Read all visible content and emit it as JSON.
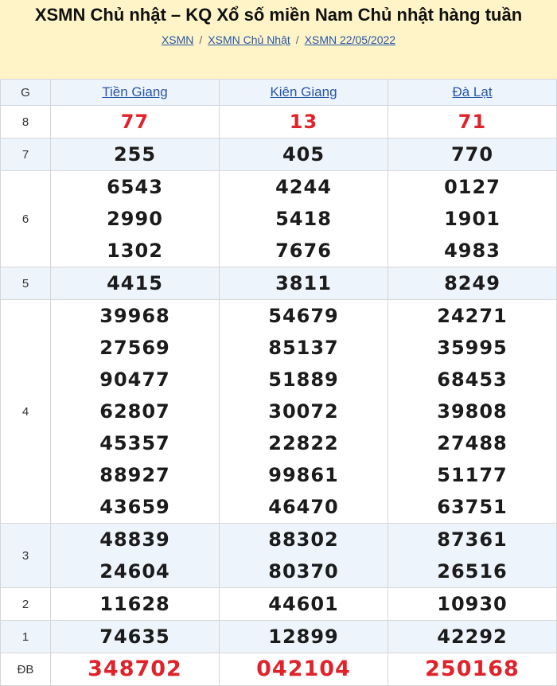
{
  "header": {
    "title": "XSMN Chủ nhật – KQ Xổ số miền Nam Chủ nhật hàng tuần",
    "breadcrumb": [
      "XSMN",
      "XSMN Chủ Nhật",
      "XSMN 22/05/2022"
    ]
  },
  "table": {
    "col_g": "G",
    "provinces": [
      "Tiền Giang",
      "Kiên Giang",
      "Đà Lạt"
    ],
    "rows": [
      {
        "g": "8",
        "vals": [
          [
            "77"
          ],
          [
            "13"
          ],
          [
            "71"
          ]
        ]
      },
      {
        "g": "7",
        "vals": [
          [
            "255"
          ],
          [
            "405"
          ],
          [
            "770"
          ]
        ]
      },
      {
        "g": "6",
        "vals": [
          [
            "6543",
            "2990",
            "1302"
          ],
          [
            "4244",
            "5418",
            "7676"
          ],
          [
            "0127",
            "1901",
            "4983"
          ]
        ]
      },
      {
        "g": "5",
        "vals": [
          [
            "4415"
          ],
          [
            "3811"
          ],
          [
            "8249"
          ]
        ]
      },
      {
        "g": "4",
        "vals": [
          [
            "39968",
            "27569",
            "90477",
            "62807",
            "45357",
            "88927",
            "43659"
          ],
          [
            "54679",
            "85137",
            "51889",
            "30072",
            "22822",
            "99861",
            "46470"
          ],
          [
            "24271",
            "35995",
            "68453",
            "39808",
            "27488",
            "51177",
            "63751"
          ]
        ]
      },
      {
        "g": "3",
        "vals": [
          [
            "48839",
            "24604"
          ],
          [
            "88302",
            "80370"
          ],
          [
            "87361",
            "26516"
          ]
        ]
      },
      {
        "g": "2",
        "vals": [
          [
            "11628"
          ],
          [
            "44601"
          ],
          [
            "10930"
          ]
        ]
      },
      {
        "g": "1",
        "vals": [
          [
            "74635"
          ],
          [
            "12899"
          ],
          [
            "42292"
          ]
        ]
      },
      {
        "g": "ĐB",
        "vals": [
          [
            "348702"
          ],
          [
            "042104"
          ],
          [
            "250168"
          ]
        ]
      }
    ]
  },
  "colors": {
    "header_bg": "#fff4c7",
    "link": "#2756a8",
    "special": "#e0232b",
    "alt_row": "#eef4fb"
  }
}
